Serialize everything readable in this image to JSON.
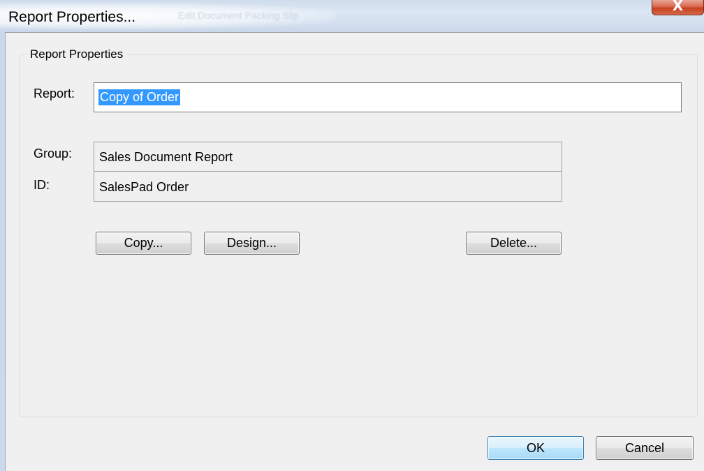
{
  "window": {
    "title": "Report Properties...",
    "ghost_title": "Edit Document Packing Slip",
    "close_glyph": "X"
  },
  "group": {
    "legend": "Report Properties"
  },
  "fields": {
    "report_label": "Report:",
    "report_value": "Copy of Order",
    "group_label": "Group:",
    "group_value": "Sales Document Report",
    "id_label": "ID:",
    "id_value": "SalesPad Order"
  },
  "buttons": {
    "copy": "Copy...",
    "design": "Design...",
    "delete": "Delete...",
    "ok": "OK",
    "cancel": "Cancel"
  },
  "colors": {
    "selection": "#3399ff",
    "close_button": "#c7401f",
    "default_button_border": "#3c7fb1"
  },
  "icons": {
    "close": "close-icon"
  }
}
